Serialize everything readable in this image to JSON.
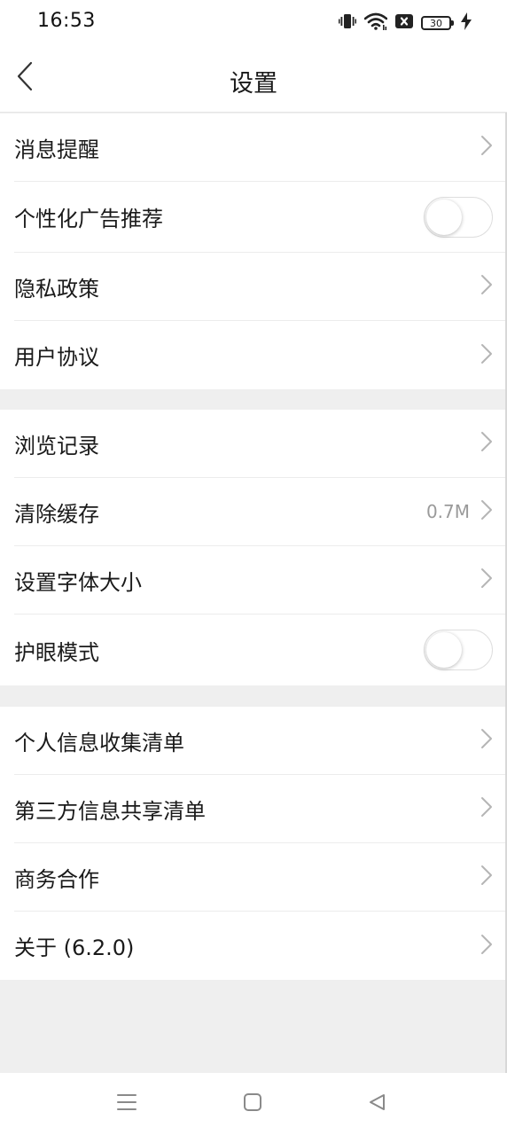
{
  "status_bar": {
    "time": "16:53",
    "battery": "30",
    "icons": [
      "vibrate-icon",
      "wifi-icon",
      "sim-off-icon",
      "battery-icon",
      "charging-icon"
    ]
  },
  "header": {
    "title": "设置",
    "back_icon": "chevron-left-icon"
  },
  "groups": [
    {
      "items": [
        {
          "label": "消息提醒",
          "type": "link"
        },
        {
          "label": "个性化广告推荐",
          "type": "toggle",
          "enabled": false
        },
        {
          "label": "隐私政策",
          "type": "link"
        },
        {
          "label": "用户协议",
          "type": "link"
        }
      ]
    },
    {
      "items": [
        {
          "label": "浏览记录",
          "type": "link"
        },
        {
          "label": "清除缓存",
          "type": "link",
          "value": "0.7M"
        },
        {
          "label": "设置字体大小",
          "type": "link"
        },
        {
          "label": "护眼模式",
          "type": "toggle",
          "enabled": false
        }
      ]
    },
    {
      "items": [
        {
          "label": "个人信息收集清单",
          "type": "link"
        },
        {
          "label": "第三方信息共享清单",
          "type": "link"
        },
        {
          "label": "商务合作",
          "type": "link"
        },
        {
          "label": "关于 (6.2.0)",
          "type": "link"
        }
      ]
    }
  ],
  "colors": {
    "background": "#efefef",
    "surface": "#ffffff",
    "text": "#1a1a1a",
    "secondary_text": "#9a9a9a",
    "chevron": "#b5b5b5",
    "divider": "#ececec"
  },
  "nav_bar": {
    "buttons": [
      "menu-icon",
      "home-square-icon",
      "back-triangle-icon"
    ]
  }
}
